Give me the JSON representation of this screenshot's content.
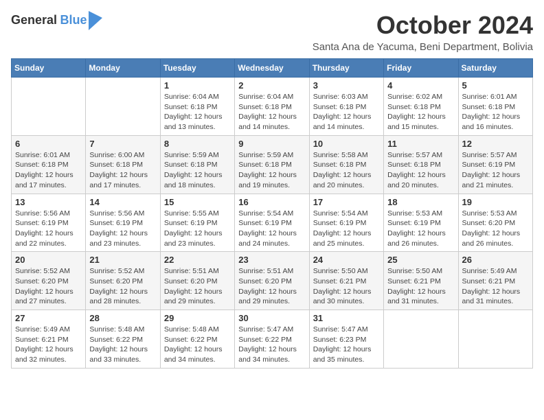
{
  "logo": {
    "line1": "General",
    "line2": "Blue"
  },
  "header": {
    "month": "October 2024",
    "location": "Santa Ana de Yacuma, Beni Department, Bolivia"
  },
  "weekdays": [
    "Sunday",
    "Monday",
    "Tuesday",
    "Wednesday",
    "Thursday",
    "Friday",
    "Saturday"
  ],
  "weeks": [
    [
      {
        "day": "",
        "info": ""
      },
      {
        "day": "",
        "info": ""
      },
      {
        "day": "1",
        "info": "Sunrise: 6:04 AM\nSunset: 6:18 PM\nDaylight: 12 hours and 13 minutes."
      },
      {
        "day": "2",
        "info": "Sunrise: 6:04 AM\nSunset: 6:18 PM\nDaylight: 12 hours and 14 minutes."
      },
      {
        "day": "3",
        "info": "Sunrise: 6:03 AM\nSunset: 6:18 PM\nDaylight: 12 hours and 14 minutes."
      },
      {
        "day": "4",
        "info": "Sunrise: 6:02 AM\nSunset: 6:18 PM\nDaylight: 12 hours and 15 minutes."
      },
      {
        "day": "5",
        "info": "Sunrise: 6:01 AM\nSunset: 6:18 PM\nDaylight: 12 hours and 16 minutes."
      }
    ],
    [
      {
        "day": "6",
        "info": "Sunrise: 6:01 AM\nSunset: 6:18 PM\nDaylight: 12 hours and 17 minutes."
      },
      {
        "day": "7",
        "info": "Sunrise: 6:00 AM\nSunset: 6:18 PM\nDaylight: 12 hours and 17 minutes."
      },
      {
        "day": "8",
        "info": "Sunrise: 5:59 AM\nSunset: 6:18 PM\nDaylight: 12 hours and 18 minutes."
      },
      {
        "day": "9",
        "info": "Sunrise: 5:59 AM\nSunset: 6:18 PM\nDaylight: 12 hours and 19 minutes."
      },
      {
        "day": "10",
        "info": "Sunrise: 5:58 AM\nSunset: 6:18 PM\nDaylight: 12 hours and 20 minutes."
      },
      {
        "day": "11",
        "info": "Sunrise: 5:57 AM\nSunset: 6:18 PM\nDaylight: 12 hours and 20 minutes."
      },
      {
        "day": "12",
        "info": "Sunrise: 5:57 AM\nSunset: 6:19 PM\nDaylight: 12 hours and 21 minutes."
      }
    ],
    [
      {
        "day": "13",
        "info": "Sunrise: 5:56 AM\nSunset: 6:19 PM\nDaylight: 12 hours and 22 minutes."
      },
      {
        "day": "14",
        "info": "Sunrise: 5:56 AM\nSunset: 6:19 PM\nDaylight: 12 hours and 23 minutes."
      },
      {
        "day": "15",
        "info": "Sunrise: 5:55 AM\nSunset: 6:19 PM\nDaylight: 12 hours and 23 minutes."
      },
      {
        "day": "16",
        "info": "Sunrise: 5:54 AM\nSunset: 6:19 PM\nDaylight: 12 hours and 24 minutes."
      },
      {
        "day": "17",
        "info": "Sunrise: 5:54 AM\nSunset: 6:19 PM\nDaylight: 12 hours and 25 minutes."
      },
      {
        "day": "18",
        "info": "Sunrise: 5:53 AM\nSunset: 6:19 PM\nDaylight: 12 hours and 26 minutes."
      },
      {
        "day": "19",
        "info": "Sunrise: 5:53 AM\nSunset: 6:20 PM\nDaylight: 12 hours and 26 minutes."
      }
    ],
    [
      {
        "day": "20",
        "info": "Sunrise: 5:52 AM\nSunset: 6:20 PM\nDaylight: 12 hours and 27 minutes."
      },
      {
        "day": "21",
        "info": "Sunrise: 5:52 AM\nSunset: 6:20 PM\nDaylight: 12 hours and 28 minutes."
      },
      {
        "day": "22",
        "info": "Sunrise: 5:51 AM\nSunset: 6:20 PM\nDaylight: 12 hours and 29 minutes."
      },
      {
        "day": "23",
        "info": "Sunrise: 5:51 AM\nSunset: 6:20 PM\nDaylight: 12 hours and 29 minutes."
      },
      {
        "day": "24",
        "info": "Sunrise: 5:50 AM\nSunset: 6:21 PM\nDaylight: 12 hours and 30 minutes."
      },
      {
        "day": "25",
        "info": "Sunrise: 5:50 AM\nSunset: 6:21 PM\nDaylight: 12 hours and 31 minutes."
      },
      {
        "day": "26",
        "info": "Sunrise: 5:49 AM\nSunset: 6:21 PM\nDaylight: 12 hours and 31 minutes."
      }
    ],
    [
      {
        "day": "27",
        "info": "Sunrise: 5:49 AM\nSunset: 6:21 PM\nDaylight: 12 hours and 32 minutes."
      },
      {
        "day": "28",
        "info": "Sunrise: 5:48 AM\nSunset: 6:22 PM\nDaylight: 12 hours and 33 minutes."
      },
      {
        "day": "29",
        "info": "Sunrise: 5:48 AM\nSunset: 6:22 PM\nDaylight: 12 hours and 34 minutes."
      },
      {
        "day": "30",
        "info": "Sunrise: 5:47 AM\nSunset: 6:22 PM\nDaylight: 12 hours and 34 minutes."
      },
      {
        "day": "31",
        "info": "Sunrise: 5:47 AM\nSunset: 6:23 PM\nDaylight: 12 hours and 35 minutes."
      },
      {
        "day": "",
        "info": ""
      },
      {
        "day": "",
        "info": ""
      }
    ]
  ]
}
